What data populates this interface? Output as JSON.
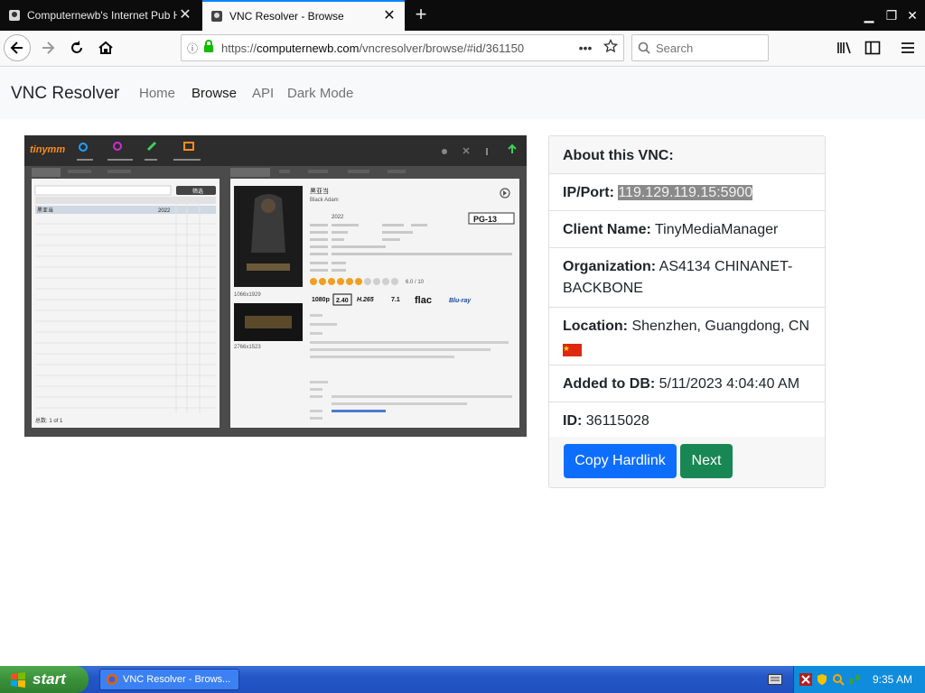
{
  "browser": {
    "tabs": [
      {
        "title": "Computernewb's Internet Pub Hub"
      },
      {
        "title": "VNC Resolver - Browse"
      }
    ],
    "url_prefix": "https://",
    "url_host": "computernewb.com",
    "url_path": "/vncresolver/browse/#id/361150",
    "search_placeholder": "Search"
  },
  "site": {
    "brand": "VNC Resolver",
    "nav": [
      "Home",
      "Browse",
      "API",
      "Dark Mode"
    ],
    "active_nav": "Browse"
  },
  "about": {
    "title": "About this VNC:",
    "ip_label": "IP/Port:",
    "ip_value": "119.129.119.15:5900",
    "client_label": "Client Name:",
    "client_value": "TinyMediaManager",
    "org_label": "Organization:",
    "org_value": "AS4134 CHINANET-BACKBONE",
    "location_label": "Location:",
    "location_value": "Shenzhen, Guangdong, CN",
    "added_label": "Added to DB:",
    "added_value": "5/11/2023 4:04:40 AM",
    "id_label": "ID:",
    "id_value": "36115028",
    "copy_button": "Copy Hardlink",
    "next_button": "Next"
  },
  "screenshot": {
    "app_logo": "tinymm",
    "movie_title_cn": "黑亚当",
    "movie_title_en": "Black Adam",
    "year": "2022",
    "rating_badge": "PG-13",
    "rating_text": "6.0 / 10",
    "codec_badges": [
      "1080p",
      "2.40",
      "H.265",
      "7.1",
      "flac",
      "Blu-ray"
    ],
    "fanart_res": "1066x1929",
    "banner_res": "2766x1523",
    "filter_button": "筛选",
    "status": "总数: 1 of 1"
  },
  "taskbar": {
    "start_label": "start",
    "task_item": "VNC Resolver - Brows...",
    "clock": "9:35 AM"
  },
  "colors": {
    "primary": "#0d6efd",
    "success": "#198754",
    "taskbar_blue": "#2457c6",
    "start_green": "#3a913a"
  }
}
